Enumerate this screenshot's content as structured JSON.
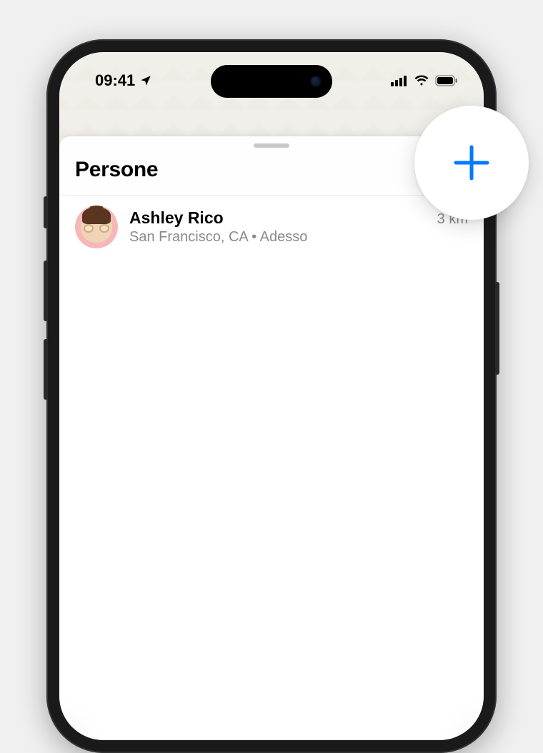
{
  "status_bar": {
    "time": "09:41",
    "location_arrow": "location-arrow-icon",
    "signal": "cellular-signal-icon",
    "wifi": "wifi-icon",
    "battery": "battery-icon"
  },
  "sheet": {
    "title": "Persone",
    "add_button": "add-person-button"
  },
  "people": [
    {
      "name": "Ashley Rico",
      "location": "San Francisco, CA • Adesso",
      "distance": "3 km"
    }
  ],
  "colors": {
    "accent": "#007aff",
    "secondary_text": "#8a8a8e"
  }
}
